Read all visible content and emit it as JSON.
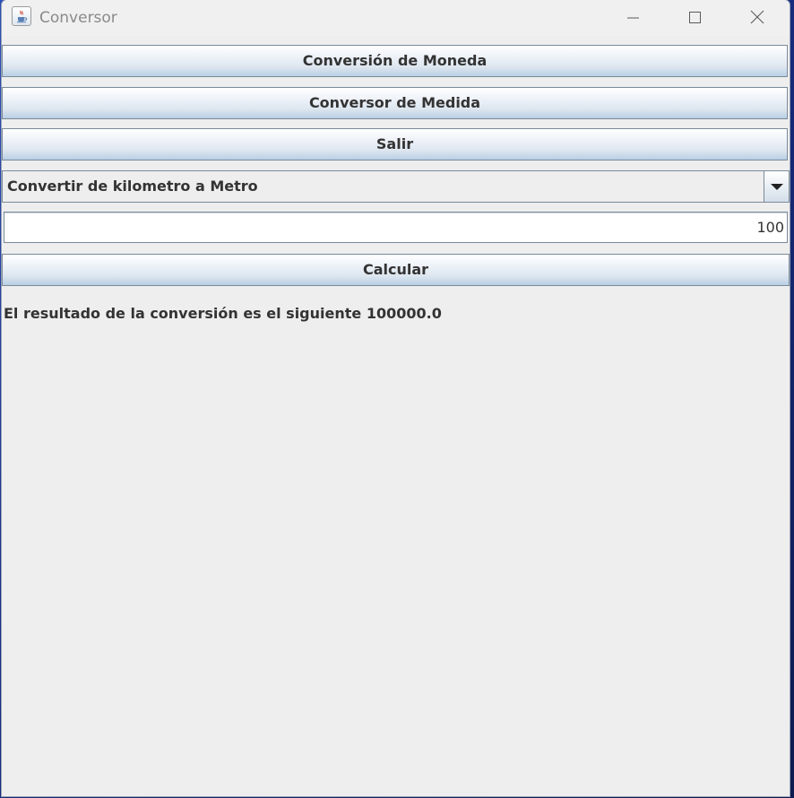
{
  "window": {
    "title": "Conversor",
    "icon": "java-cup-icon"
  },
  "buttons": {
    "currency_label": "Conversión de Moneda",
    "measure_label": "Conversor de Medida",
    "exit_label": "Salir",
    "calculate_label": "Calcular"
  },
  "combo": {
    "selected": "Convertir de kilometro a Metro"
  },
  "input": {
    "value": "100"
  },
  "result": {
    "text": "El resultado de la conversión es el siguiente 100000.0"
  }
}
